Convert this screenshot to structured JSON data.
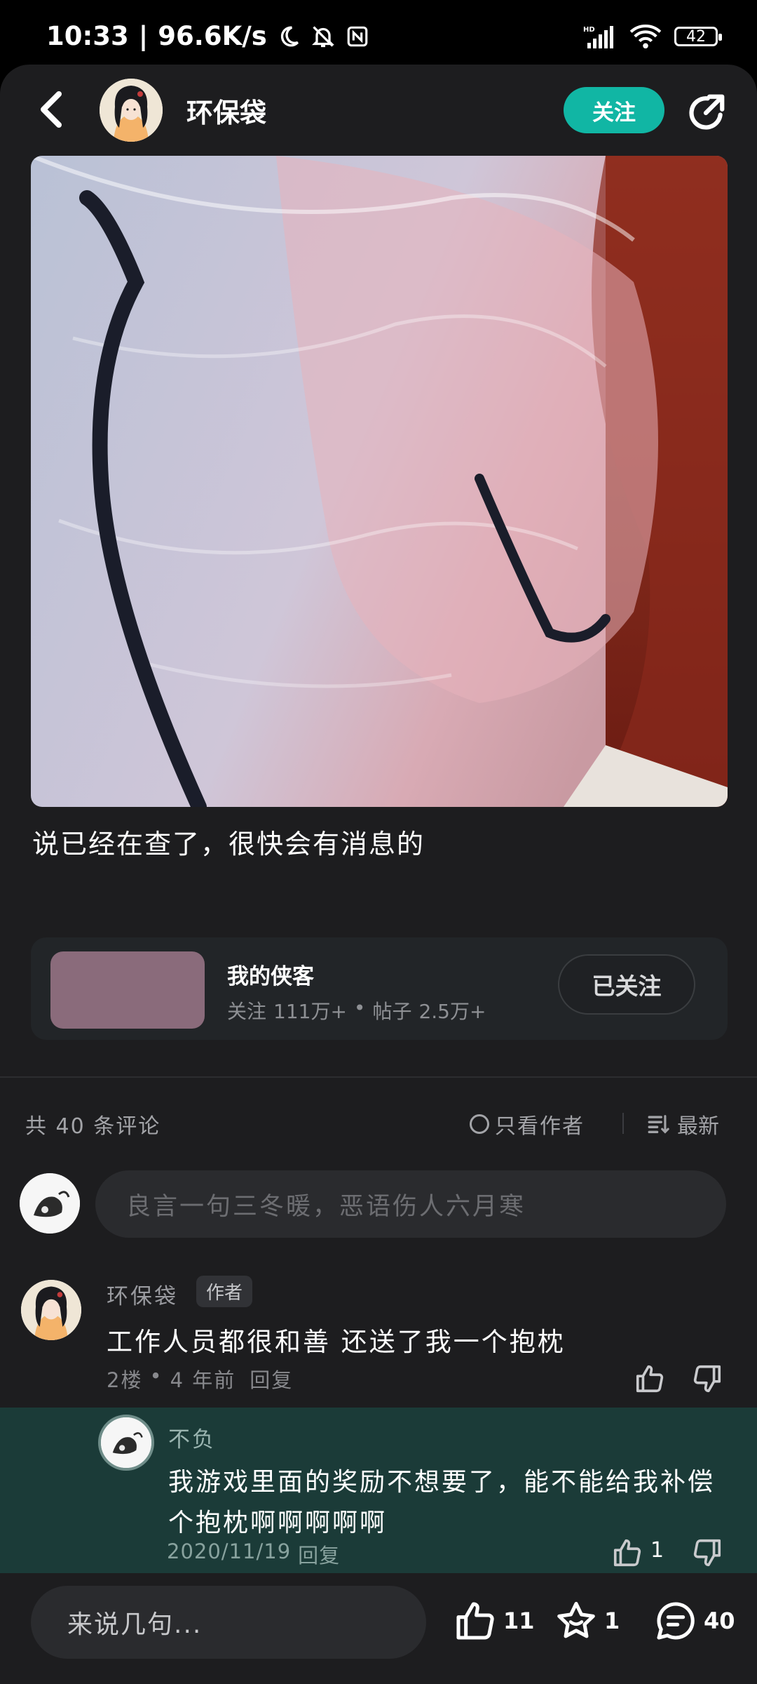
{
  "status": {
    "time": "10:33",
    "net_speed": "96.6K/s",
    "battery": "42",
    "signal_label": "HD"
  },
  "header": {
    "author_name": "环保袋",
    "follow_label": "关注"
  },
  "post": {
    "text": "说已经在查了，很快会有消息的"
  },
  "community_card": {
    "title": "我的侠客",
    "followers_label": "关注",
    "followers": "111万+",
    "dot": "•",
    "posts_label": "帖子",
    "posts": "2.5万+",
    "button_label": "已关注"
  },
  "comments": {
    "count_label": "共 40 条评论",
    "only_author_label": "只看作者",
    "sort_label": "最新",
    "input_placeholder": "良言一句三冬暖，恶语伤人六月寒",
    "items": [
      {
        "name": "环保袋",
        "badge": "作者",
        "text": "工作人员都很和善 还送了我一个抱枕",
        "floor": "2楼",
        "dot": "•",
        "time": "4 年前",
        "reply_label": "回复"
      }
    ],
    "reply": {
      "name": "不负",
      "text": "我游戏里面的奖励不想要了，能不能给我补偿个抱枕啊啊啊啊啊",
      "date": "2020/11/19",
      "reply_label": "回复",
      "like_count": "1"
    }
  },
  "bottom_bar": {
    "input_placeholder": "来说几句...",
    "likes": "11",
    "favorites": "1",
    "comments": "40"
  },
  "colors": {
    "accent": "#11b6a4",
    "background": "#1d1d1f",
    "reply_highlight": "#1b3b38"
  }
}
